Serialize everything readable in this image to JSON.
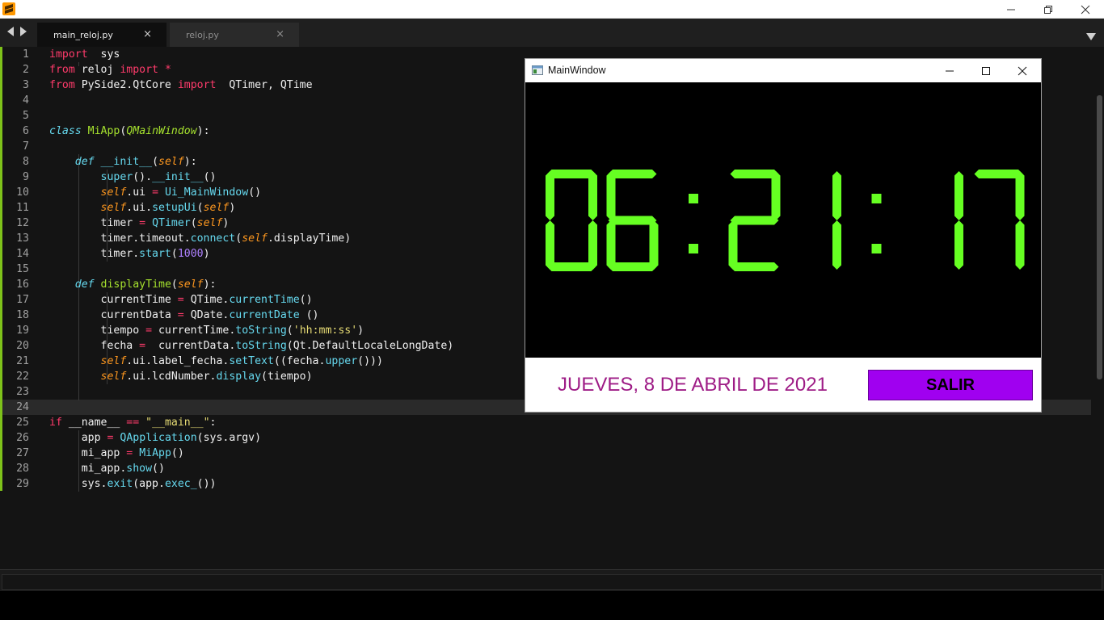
{
  "editor": {
    "tabs": [
      {
        "label": "main_reloj.py",
        "close": "×"
      },
      {
        "label": "reloj.py",
        "close": "×"
      }
    ],
    "lines": [
      [
        [
          "kw",
          "import"
        ],
        [
          "",
          "  sys"
        ]
      ],
      [
        [
          "kw",
          "from"
        ],
        [
          "",
          " reloj "
        ],
        [
          "kw",
          "import"
        ],
        [
          "",
          " "
        ],
        [
          "op",
          "*"
        ]
      ],
      [
        [
          "kw",
          "from"
        ],
        [
          "",
          " PySide2.QtCore "
        ],
        [
          "kw",
          "import"
        ],
        [
          "",
          "  QTimer, QTime"
        ]
      ],
      [],
      [],
      [
        [
          "it",
          "class"
        ],
        [
          "",
          " "
        ],
        [
          "cls",
          "MiApp"
        ],
        [
          "",
          "("
        ],
        [
          "cls-i",
          "QMainWindow"
        ],
        [
          "",
          "):"
        ]
      ],
      [],
      [
        [
          "",
          "    "
        ],
        [
          "it",
          "def"
        ],
        [
          "",
          " "
        ],
        [
          "fn",
          "__init__"
        ],
        [
          "",
          "("
        ],
        [
          "self",
          "self"
        ],
        [
          "",
          "):"
        ]
      ],
      [
        [
          "",
          "        "
        ],
        [
          "fn",
          "super"
        ],
        [
          "",
          "()."
        ],
        [
          "fn",
          "__init__"
        ],
        [
          "",
          "()"
        ]
      ],
      [
        [
          "",
          "        "
        ],
        [
          "self",
          "self"
        ],
        [
          "",
          ".ui "
        ],
        [
          "op",
          "="
        ],
        [
          "",
          " "
        ],
        [
          "fn",
          "Ui_MainWindow"
        ],
        [
          "",
          "()"
        ]
      ],
      [
        [
          "",
          "        "
        ],
        [
          "self",
          "self"
        ],
        [
          "",
          ".ui."
        ],
        [
          "fn",
          "setupUi"
        ],
        [
          "",
          "("
        ],
        [
          "self",
          "self"
        ],
        [
          "",
          ")"
        ]
      ],
      [
        [
          "",
          "        timer "
        ],
        [
          "op",
          "="
        ],
        [
          "",
          " "
        ],
        [
          "fn",
          "QTimer"
        ],
        [
          "",
          "("
        ],
        [
          "self",
          "self"
        ],
        [
          "",
          ")"
        ]
      ],
      [
        [
          "",
          "        timer.timeout."
        ],
        [
          "fn",
          "connect"
        ],
        [
          "",
          "("
        ],
        [
          "self",
          "self"
        ],
        [
          "",
          ".displayTime)"
        ]
      ],
      [
        [
          "",
          "        timer."
        ],
        [
          "fn",
          "start"
        ],
        [
          "",
          "("
        ],
        [
          "num",
          "1000"
        ],
        [
          "",
          ")"
        ]
      ],
      [],
      [
        [
          "",
          "    "
        ],
        [
          "it",
          "def"
        ],
        [
          "",
          " "
        ],
        [
          "cls",
          "displayTime"
        ],
        [
          "",
          "("
        ],
        [
          "self",
          "self"
        ],
        [
          "",
          "):"
        ]
      ],
      [
        [
          "",
          "        currentTime "
        ],
        [
          "op",
          "="
        ],
        [
          "",
          " QTime."
        ],
        [
          "fn",
          "currentTime"
        ],
        [
          "",
          "()"
        ]
      ],
      [
        [
          "",
          "        currentData "
        ],
        [
          "op",
          "="
        ],
        [
          "",
          " QDate."
        ],
        [
          "fn",
          "currentDate"
        ],
        [
          "",
          " ()"
        ]
      ],
      [
        [
          "",
          "        tiempo "
        ],
        [
          "op",
          "="
        ],
        [
          "",
          " currentTime."
        ],
        [
          "fn",
          "toString"
        ],
        [
          "",
          "("
        ],
        [
          "str",
          "'hh:mm:ss'"
        ],
        [
          "",
          ")"
        ]
      ],
      [
        [
          "",
          "        fecha "
        ],
        [
          "op",
          "="
        ],
        [
          "",
          "  currentData."
        ],
        [
          "fn",
          "toString"
        ],
        [
          "",
          "(Qt.DefaultLocaleLongDate)"
        ]
      ],
      [
        [
          "",
          "        "
        ],
        [
          "self",
          "self"
        ],
        [
          "",
          ".ui.label_fecha."
        ],
        [
          "fn",
          "setText"
        ],
        [
          "",
          "((fecha."
        ],
        [
          "fn",
          "upper"
        ],
        [
          "",
          "()))"
        ]
      ],
      [
        [
          "",
          "        "
        ],
        [
          "self",
          "self"
        ],
        [
          "",
          ".ui.lcdNumber."
        ],
        [
          "fn",
          "display"
        ],
        [
          "",
          "(tiempo)"
        ]
      ],
      [],
      [],
      [
        [
          "kw",
          "if"
        ],
        [
          "",
          " __name__ "
        ],
        [
          "op",
          "=="
        ],
        [
          "",
          " "
        ],
        [
          "str",
          "\"__main__\""
        ],
        [
          "",
          ":"
        ]
      ],
      [
        [
          "",
          "     app "
        ],
        [
          "op",
          "="
        ],
        [
          "",
          " "
        ],
        [
          "fn",
          "QApplication"
        ],
        [
          "",
          "(sys.argv)"
        ]
      ],
      [
        [
          "",
          "     mi_app "
        ],
        [
          "op",
          "="
        ],
        [
          "",
          " "
        ],
        [
          "fn",
          "MiApp"
        ],
        [
          "",
          "()"
        ]
      ],
      [
        [
          "",
          "     mi_app."
        ],
        [
          "fn",
          "show"
        ],
        [
          "",
          "()"
        ]
      ],
      [
        [
          "",
          "     sys."
        ],
        [
          "fn",
          "exit"
        ],
        [
          "",
          "(app."
        ],
        [
          "fn",
          "exec_"
        ],
        [
          "",
          "())"
        ]
      ]
    ],
    "line_count": 29,
    "highlighted_line": 24
  },
  "qt_window": {
    "title": "MainWindow",
    "lcd_time": "06:21:17",
    "lcd_color": "#66ff22",
    "date_label": "JUEVES, 8 DE ABRIL DE 2021",
    "button_label": "SALIR"
  },
  "colors": {
    "editor_bg": "#141414",
    "keyword": "#ff3b6b",
    "function": "#66d9ef",
    "class": "#a6e22e",
    "self": "#fd971f",
    "number": "#ae81ff",
    "string": "#e6db74",
    "button_bg": "#a000f0",
    "date_text": "#9e1c86"
  }
}
